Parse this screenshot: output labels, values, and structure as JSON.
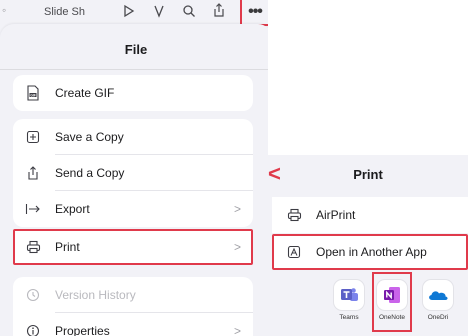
{
  "toolbar": {
    "slideshow_text": "Slide Sh",
    "more_label": "•••"
  },
  "file_sheet": {
    "title": "File",
    "groups": [
      [
        {
          "label": "Create GIF",
          "icon": "gif-icon"
        }
      ],
      [
        {
          "label": "Save a Copy",
          "icon": "save-copy-icon"
        },
        {
          "label": "Send a Copy",
          "icon": "share-icon"
        },
        {
          "label": "Export",
          "icon": "export-icon",
          "chevron": ">"
        }
      ],
      [
        {
          "label": "Print",
          "icon": "printer-icon",
          "chevron": ">",
          "highlighted": true
        }
      ],
      [
        {
          "label": "Version History",
          "icon": "history-icon",
          "disabled": true
        },
        {
          "label": "Properties",
          "icon": "info-icon",
          "chevron": ">"
        }
      ]
    ]
  },
  "print_sheet": {
    "back_glyph": "<",
    "title": "Print",
    "rows": [
      {
        "label": "AirPrint",
        "icon": "printer-icon"
      },
      {
        "label": "Open in Another App",
        "icon": "open-in-app-icon",
        "highlighted": true
      }
    ],
    "apps": [
      {
        "name": "Teams",
        "icon": "teams-icon"
      },
      {
        "name": "OneNote",
        "icon": "onenote-icon",
        "highlighted": true
      },
      {
        "name": "OneDri",
        "icon": "onedrive-icon"
      }
    ]
  },
  "colors": {
    "highlight": "#e03a4b",
    "sheet_bg": "#f2f2f7",
    "teams": "#5b5fc7",
    "onenote": "#7719aa",
    "onedrive": "#0f78d4"
  }
}
